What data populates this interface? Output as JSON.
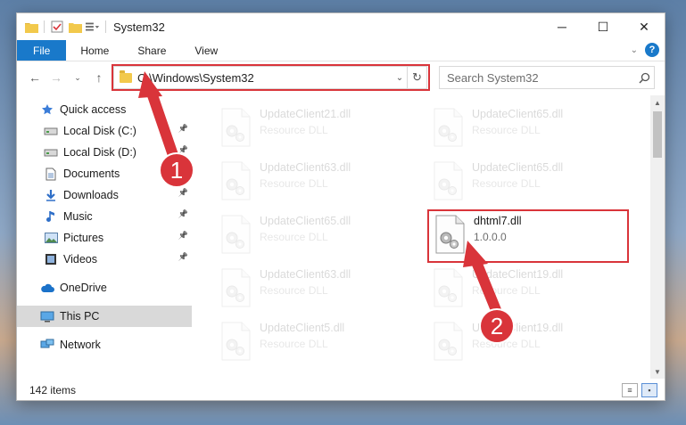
{
  "window": {
    "title": "System32"
  },
  "ribbon": {
    "tabs": [
      "File",
      "Home",
      "Share",
      "View"
    ]
  },
  "address": {
    "path": "C:\\Windows\\System32"
  },
  "search": {
    "placeholder": "Search System32"
  },
  "sidebar": {
    "items": [
      {
        "label": "Quick access",
        "icon": "star-icon",
        "level": 0,
        "pinned": false
      },
      {
        "label": "Local Disk (C:)",
        "icon": "drive-icon",
        "level": 1,
        "pinned": true
      },
      {
        "label": "Local Disk (D:)",
        "icon": "drive-icon",
        "level": 1,
        "pinned": true
      },
      {
        "label": "Documents",
        "icon": "document-icon",
        "level": 1,
        "pinned": true
      },
      {
        "label": "Downloads",
        "icon": "download-icon",
        "level": 1,
        "pinned": true
      },
      {
        "label": "Music",
        "icon": "music-icon",
        "level": 1,
        "pinned": true
      },
      {
        "label": "Pictures",
        "icon": "pictures-icon",
        "level": 1,
        "pinned": true
      },
      {
        "label": "Videos",
        "icon": "video-icon",
        "level": 1,
        "pinned": true
      },
      {
        "label": "OneDrive",
        "icon": "cloud-icon",
        "level": 0,
        "pinned": false
      },
      {
        "label": "This PC",
        "icon": "computer-icon",
        "level": 0,
        "pinned": false,
        "selected": true
      },
      {
        "label": "Network",
        "icon": "network-icon",
        "level": 0,
        "pinned": false
      }
    ]
  },
  "files": [
    {
      "name": "UpdateClient21.dll",
      "desc": "Resource DLL",
      "faded": true
    },
    {
      "name": "UpdateClient65.dll",
      "desc": "Resource DLL",
      "faded": true
    },
    {
      "name": "UpdateClient63.dll",
      "desc": "Resource DLL",
      "faded": true
    },
    {
      "name": "UpdateClient65.dll",
      "desc": "Resource DLL",
      "faded": true
    },
    {
      "name": "UpdateClient65.dll",
      "desc": "Resource DLL",
      "faded": true
    },
    {
      "name": "dhtml7.dll",
      "desc": "1.0.0.0",
      "faded": false,
      "highlighted": true
    },
    {
      "name": "UpdateClient63.dll",
      "desc": "Resource DLL",
      "faded": true
    },
    {
      "name": "UpdateClient19.dll",
      "desc": "Resource DLL",
      "faded": true
    },
    {
      "name": "UpdateClient5.dll",
      "desc": "Resource DLL",
      "faded": true
    },
    {
      "name": "UpdateClient19.dll",
      "desc": "Resource DLL",
      "faded": true
    }
  ],
  "status": {
    "item_count": "142 items"
  },
  "callouts": [
    "1",
    "2"
  ],
  "colors": {
    "accent": "#1979ca",
    "highlight": "#d9343a"
  }
}
